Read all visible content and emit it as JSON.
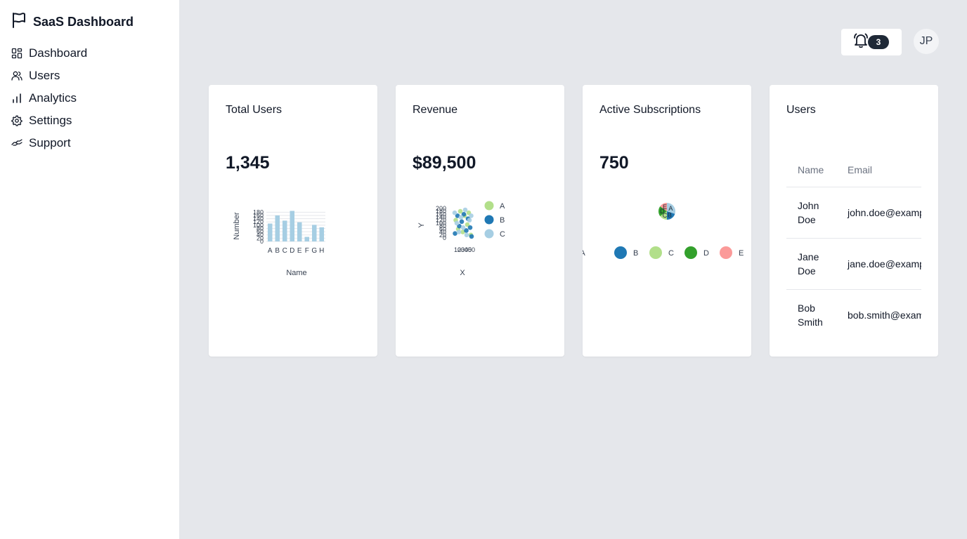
{
  "app": {
    "title": "SaaS Dashboard"
  },
  "sidebar": {
    "items": [
      {
        "label": "Dashboard",
        "icon": "dashboard-icon"
      },
      {
        "label": "Users",
        "icon": "users-icon"
      },
      {
        "label": "Analytics",
        "icon": "bar-chart-icon"
      },
      {
        "label": "Settings",
        "icon": "gear-icon"
      },
      {
        "label": "Support",
        "icon": "handshake-icon"
      }
    ]
  },
  "header": {
    "notifications_count": "3",
    "avatar_initials": "JP"
  },
  "cards": {
    "total_users": {
      "title": "Total Users",
      "value": "1,345"
    },
    "revenue": {
      "title": "Revenue",
      "value": "$89,500"
    },
    "subscriptions": {
      "title": "Active Subscriptions",
      "value": "750"
    },
    "users": {
      "title": "Users",
      "columns": [
        "Name",
        "Email"
      ],
      "rows": [
        {
          "name": "John Doe",
          "email": "john.doe@example.com"
        },
        {
          "name": "Jane Doe",
          "email": "jane.doe@example.com"
        },
        {
          "name": "Bob Smith",
          "email": "bob.smith@example.com"
        }
      ]
    }
  },
  "chart_data": [
    {
      "type": "bar",
      "categories": [
        "A",
        "B",
        "C",
        "D",
        "E",
        "F",
        "G",
        "H"
      ],
      "values": [
        110,
        160,
        128,
        188,
        118,
        28,
        102,
        87
      ],
      "xlabel": "Name",
      "ylabel": "Number",
      "yticks": [
        0,
        20,
        40,
        60,
        80,
        100,
        120,
        140,
        160,
        180
      ],
      "ylim": [
        0,
        190
      ],
      "color": "#a6cee3",
      "grid": true
    },
    {
      "type": "scatter",
      "xlabel": "X",
      "ylabel": "Y",
      "legend": "right",
      "series": [
        {
          "name": "A",
          "color": "#b2df8a",
          "points": [
            [
              5,
              120
            ],
            [
              12,
              60
            ],
            [
              18,
              180
            ],
            [
              25,
              40
            ],
            [
              30,
              150
            ],
            [
              38,
              90
            ],
            [
              42,
              170
            ],
            [
              48,
              20
            ]
          ]
        },
        {
          "name": "B",
          "color": "#1f78b4",
          "points": [
            [
              3,
              30
            ],
            [
              10,
              150
            ],
            [
              15,
              80
            ],
            [
              22,
              110
            ],
            [
              28,
              160
            ],
            [
              35,
              50
            ],
            [
              40,
              130
            ],
            [
              46,
              70
            ],
            [
              50,
              10
            ]
          ]
        },
        {
          "name": "C",
          "color": "#a6cee3",
          "points": [
            [
              2,
              170
            ],
            [
              8,
              100
            ],
            [
              14,
              40
            ],
            [
              20,
              140
            ],
            [
              26,
              70
            ],
            [
              32,
              190
            ],
            [
              36,
              20
            ],
            [
              44,
              120
            ],
            [
              49,
              150
            ]
          ]
        }
      ]
    },
    {
      "type": "pie",
      "legend": "bottom",
      "labels": [
        "A",
        "B",
        "C",
        "D",
        "E"
      ],
      "values": [
        30,
        20,
        15,
        20,
        15
      ],
      "colors": [
        "#a6cee3",
        "#1f78b4",
        "#b2df8a",
        "#33a02c",
        "#fb9a99"
      ]
    }
  ]
}
